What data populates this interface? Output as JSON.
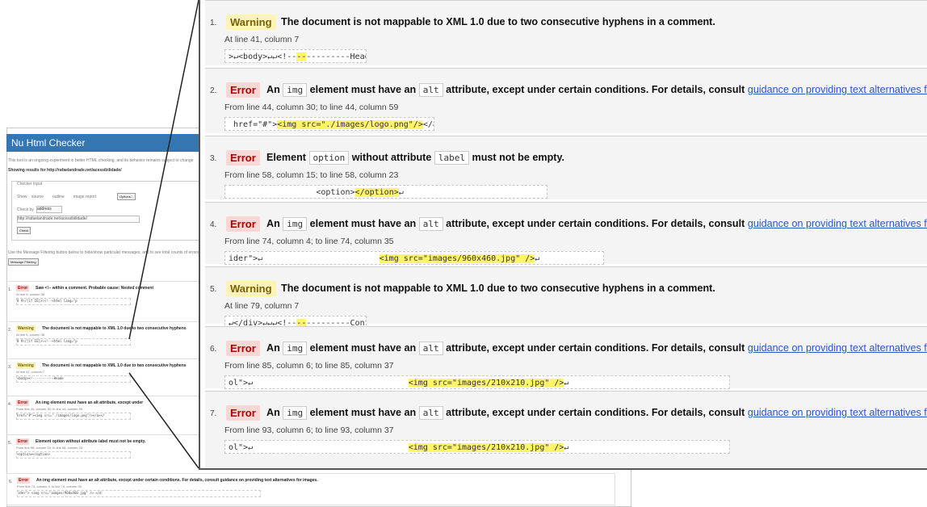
{
  "background_page": {
    "app_title": "Nu Html Checker",
    "intro_text": "This tool is an ongoing experiment in better HTML checking, and its behavior remains subject to change",
    "results_for": "Showing results for http://rafaelandrade.net/acessibilidade/",
    "checker_input_legend": "Checker Input",
    "show_label": "Show",
    "show_options": [
      "source",
      "outline",
      "image report"
    ],
    "options_button": "Options...",
    "check_by_label": "Check by",
    "check_by_value": "address",
    "address_value": "http://rafaelandrade.net/acessibilidade/",
    "check_button": "Check",
    "filter_hint": "Use the Message Filtering button below to hide/show particular messages, and to see total counts of errors and warnings.",
    "message_filtering_button": "Message Filtering",
    "messages": [
      {
        "num": "1.",
        "type": "Error",
        "text": "Saw <!-- within a comment. Probable cause: Nested comment",
        "loc": "At line 5, column 38",
        "code": "8 9\\/[if IE]>\\<!--<html lang=\"p"
      },
      {
        "num": "2.",
        "type": "Warning",
        "text": "The document is not mappable to XML 1.0 due to two consecutive hyphens",
        "loc": "At line 5, column 38",
        "code": "8 9\\/[if IE]>\\<!--<html lang=\"p"
      },
      {
        "num": "3.",
        "type": "Warning",
        "text": "The document is not mappable to XML 1.0 due to two consecutive hyphens",
        "loc": "At line 41, column 7",
        "code": "<body><!-----------Heade"
      },
      {
        "num": "4.",
        "type": "Error",
        "text": "An img element must have an alt attribute, except under",
        "loc": "From line 44, column 30; to line 44, column 59",
        "code": "href=\"#\"><img src=\"./images/logo.png\"/></a></"
      },
      {
        "num": "5.",
        "type": "Error",
        "text": "Element option without attribute label must not be empty.",
        "loc": "From line 58, column 15; to line 58, column 23",
        "code": "<option></option>"
      },
      {
        "num": "6.",
        "type": "Error",
        "text": "An img element must have an alt attribute, except under certain conditions. For details, consult guidance on providing text alternatives for images.",
        "loc": "From line 74, column 4; to line 74, column 35",
        "code": "ider\"> <img src=\"images/960x460.jpg\" /> </d"
      }
    ]
  },
  "zoom_panel": {
    "items": [
      {
        "num": "1.",
        "type": "Warning",
        "pre": "The document is not mappable to XML 1.0 due to two consecutive hyphens in a comment.",
        "loc": "At line 41, column 7",
        "code_pre": ">↵<body>↵↵<!--",
        "code_hl": "--",
        "code_post": "---------Heade"
      },
      {
        "num": "2.",
        "type": "Error",
        "pre": "An",
        "code1": "img",
        "mid": "element must have an",
        "code2": "alt",
        "post": "attribute, except under certain conditions. For details, consult",
        "link": "guidance on providing text alternatives for images",
        "loc": "From line 44, column 30; to line 44, column 59",
        "code_pre": " href=\"#\">",
        "code_hl": "<img src=\"./images/logo.png\"/>",
        "code_post": "</a></"
      },
      {
        "num": "3.",
        "type": "Error",
        "pre": "Element",
        "code1": "option",
        "mid": "without attribute",
        "code2": "label",
        "post": "must not be empty.",
        "loc": "From line 58, column 15; to line 58, column 23",
        "code_pre": "                  <option>",
        "code_hl": "</option>",
        "code_post": "↵"
      },
      {
        "num": "4.",
        "type": "Error",
        "pre": "An",
        "code1": "img",
        "mid": "element must have an",
        "code2": "alt",
        "post": "attribute, except under certain conditions. For details, consult",
        "link": "guidance on providing text alternatives for images",
        "loc": "From line 74, column 4; to line 74, column 35",
        "code_pre": "ider\">↵                        ",
        "code_hl": "<img src=\"images/960x460.jpg\" />",
        "code_post": "↵                    </d"
      },
      {
        "num": "5.",
        "type": "Warning",
        "pre": "The document is not mappable to XML 1.0 due to two consecutive hyphens in a comment.",
        "loc": "At line 79, column 7",
        "code_pre": "↵</div>↵↵↵<!--",
        "code_hl": "--",
        "code_post": "---------Conte"
      },
      {
        "num": "6.",
        "type": "Error",
        "pre": "An",
        "code1": "img",
        "mid": "element must have an",
        "code2": "alt",
        "post": "attribute, except under certain conditions. For details, consult",
        "link": "guidance on providing text alternatives for images",
        "loc": "From line 85, column 6; to line 85, column 37",
        "code_pre": "ol\">↵                                ",
        "code_hl": "<img src=\"images/210x210.jpg\" />",
        "code_post": "↵"
      },
      {
        "num": "7.",
        "type": "Error",
        "pre": "An",
        "code1": "img",
        "mid": "element must have an",
        "code2": "alt",
        "post": "attribute, except under certain conditions. For details, consult",
        "link": "guidance on providing text alternatives for images",
        "loc": "From line 93, column 6; to line 93, column 37",
        "code_pre": "ol\">↵                                ",
        "code_hl": "<img src=\"images/210x210.jpg\" />",
        "code_post": "↵"
      }
    ]
  },
  "colors": {
    "error_bg": "#f8d7d4",
    "warning_bg": "#fbf3b7",
    "header_blue": "#3476b1",
    "highlight": "#fff568",
    "link": "#2a56c6"
  }
}
